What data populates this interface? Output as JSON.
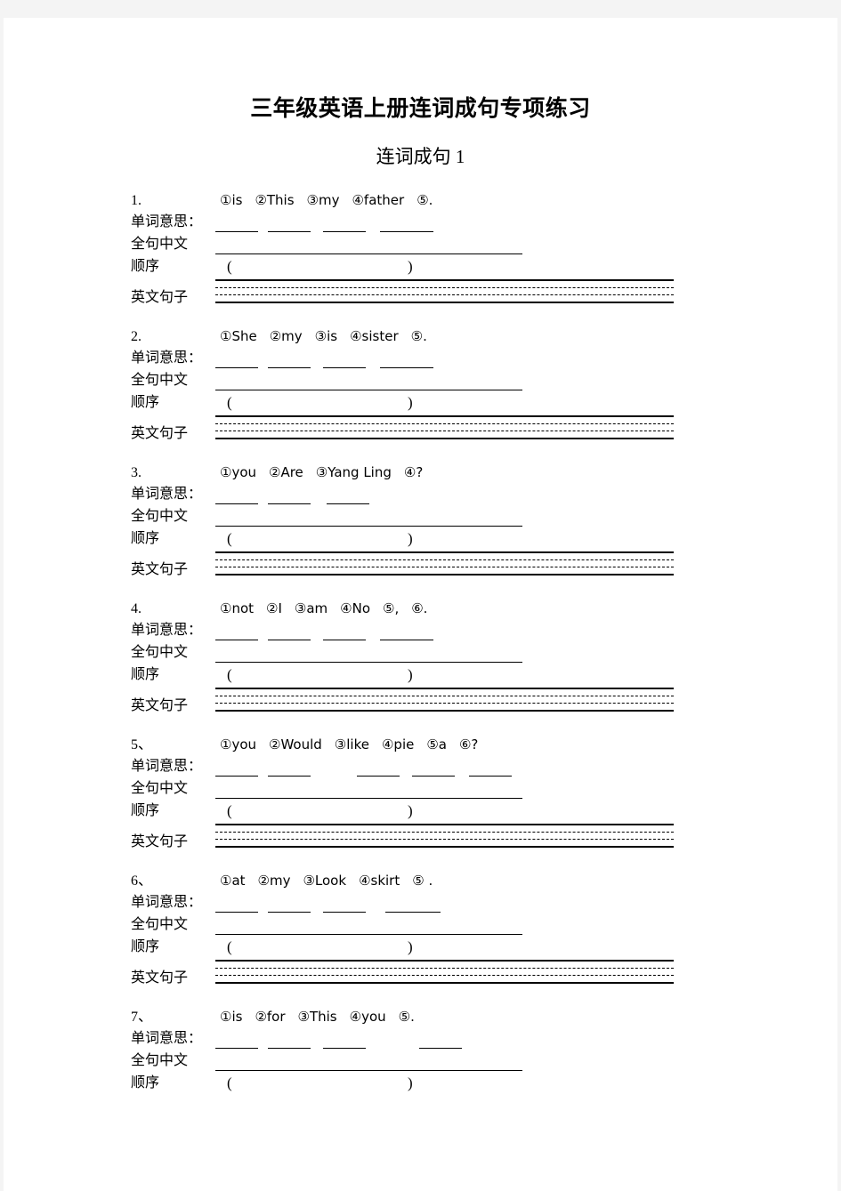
{
  "document": {
    "title": "三年级英语上册连词成句专项练习",
    "subtitle": "连词成句 1"
  },
  "labels": {
    "word_meaning": "单词意思：",
    "full_sentence_chinese": "全句中文",
    "order": "顺序",
    "english_sentence": "英文句子",
    "paren_left": "(",
    "paren_right": ")"
  },
  "exercises": [
    {
      "number": "1.",
      "tokens": [
        "①is",
        "②This",
        "③my",
        "④father",
        "⑤."
      ],
      "blank_count": 4,
      "has_english_lines": true
    },
    {
      "number": "2.",
      "tokens": [
        "①She",
        "②my",
        "③is",
        "④sister",
        "⑤."
      ],
      "blank_count": 4,
      "has_english_lines": true
    },
    {
      "number": "3.",
      "tokens": [
        "①you",
        "②Are",
        "③Yang Ling",
        "④?"
      ],
      "blank_count": 3,
      "has_english_lines": true
    },
    {
      "number": "4.",
      "tokens": [
        "①not",
        "②I",
        "③am",
        "④No",
        "⑤,",
        "⑥."
      ],
      "blank_count": 4,
      "has_english_lines": true
    },
    {
      "number": "5、",
      "tokens": [
        "①you",
        "②Would",
        "③like",
        "④pie",
        "⑤a",
        "⑥?"
      ],
      "blank_count": 5,
      "has_english_lines": true
    },
    {
      "number": "6、",
      "tokens": [
        "①at",
        "②my",
        "③Look",
        "④skirt",
        "⑤ ."
      ],
      "blank_count": 4,
      "has_english_lines": true
    },
    {
      "number": "7、",
      "tokens": [
        "①is",
        "②for",
        "③This",
        "④you",
        "⑤."
      ],
      "blank_count": 4,
      "has_english_lines": false
    }
  ]
}
